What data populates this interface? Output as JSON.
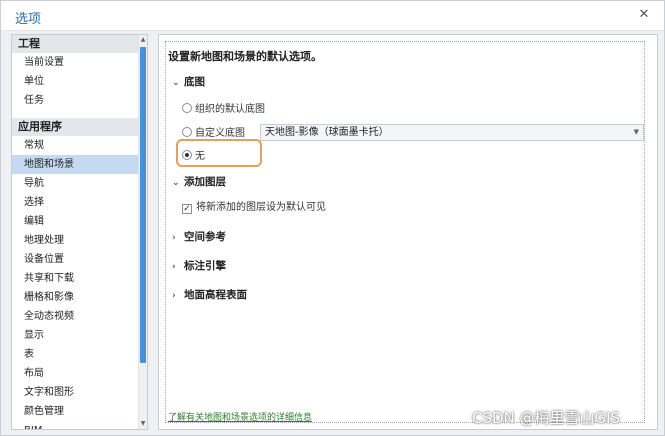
{
  "window": {
    "title": "选项"
  },
  "nav": {
    "groups": [
      {
        "header": "工程",
        "items": [
          "当前设置",
          "单位",
          "任务"
        ]
      },
      {
        "header": "应用程序",
        "items": [
          "常规",
          "地图和场景",
          "导航",
          "选择",
          "编辑",
          "地理处理",
          "设备位置",
          "共享和下载",
          "栅格和影像",
          "全动态视频",
          "显示",
          "表",
          "布局",
          "文字和图形",
          "颜色管理",
          "BIM"
        ]
      }
    ],
    "selected": "地图和场景"
  },
  "content": {
    "heading": "设置新地图和场景的默认选项。",
    "basemap": {
      "title": "底图",
      "options": [
        "组织的默认底图",
        "自定义底图",
        "无"
      ],
      "selected": "无",
      "custom_value": "天地图-影像（球面墨卡托）"
    },
    "add_layers": {
      "title": "添加图层",
      "checkbox_label": "将新添加的图层设为默认可见",
      "checked": true
    },
    "collapsed_sections": [
      "空间参考",
      "标注引擎",
      "地面高程表面"
    ],
    "link": "了解有关地图和场景选项的详细信息"
  },
  "watermark": "CSDN @梅里雪山GIS"
}
